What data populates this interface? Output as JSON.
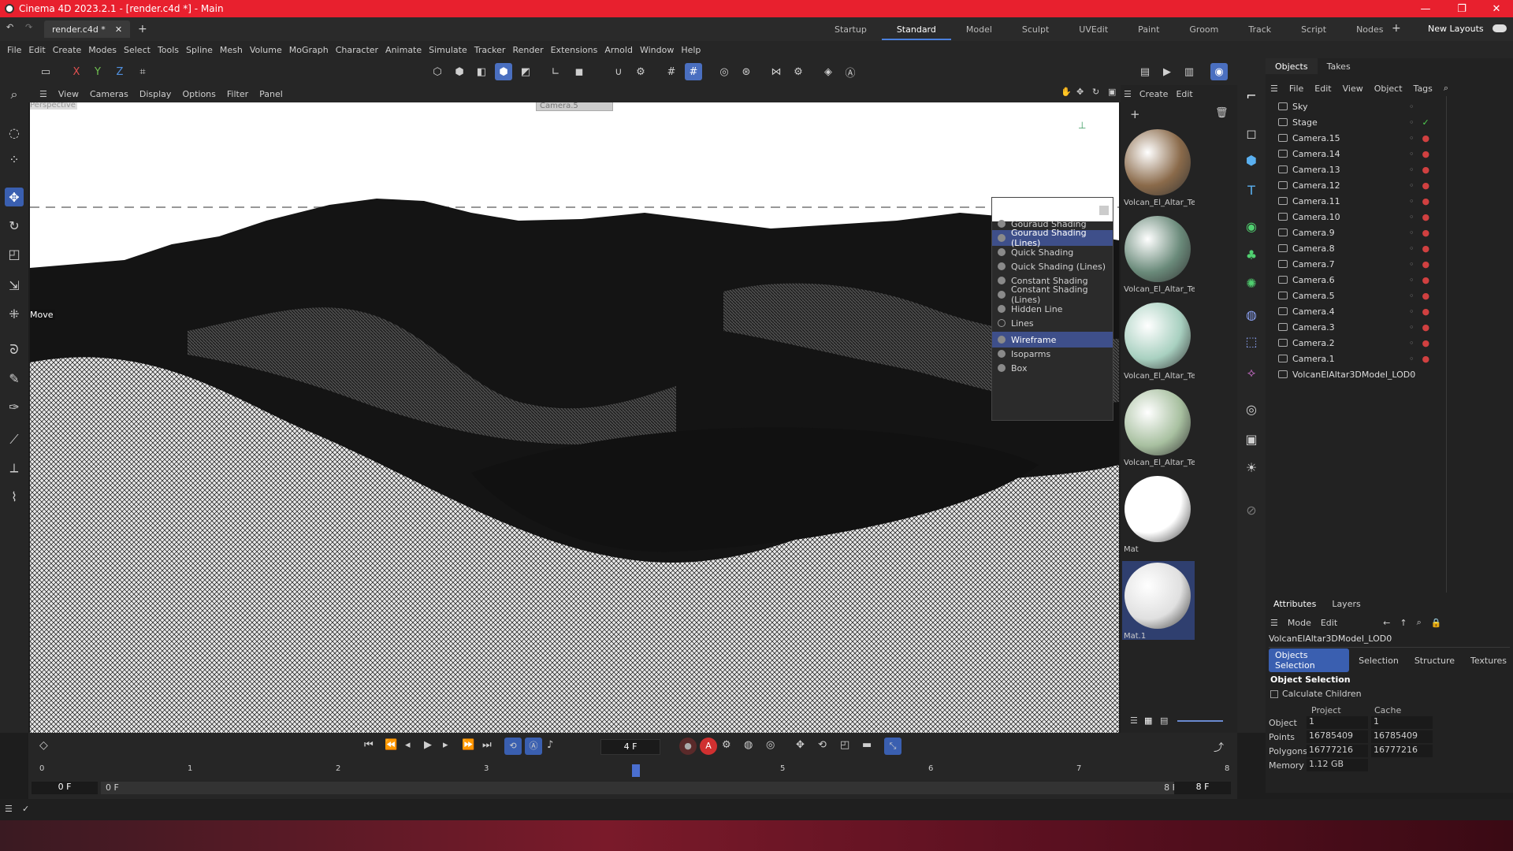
{
  "window": {
    "title": "Cinema 4D 2023.2.1 - [render.c4d *] - Main"
  },
  "doc_tab": {
    "label": "render.c4d *"
  },
  "layouts": [
    "Startup",
    "Standard",
    "Model",
    "Sculpt",
    "UVEdit",
    "Paint",
    "Groom",
    "Track",
    "Script",
    "Nodes"
  ],
  "layouts_active": "Standard",
  "new_layouts_label": "New Layouts",
  "menu": [
    "File",
    "Edit",
    "Create",
    "Modes",
    "Select",
    "Tools",
    "Spline",
    "Mesh",
    "Volume",
    "MoGraph",
    "Character",
    "Animate",
    "Simulate",
    "Tracker",
    "Render",
    "Extensions",
    "Arnold",
    "Window",
    "Help"
  ],
  "axis_labels": {
    "x": "X",
    "y": "Y",
    "z": "Z"
  },
  "viewport": {
    "menu": [
      "View",
      "Cameras",
      "Display",
      "Options",
      "Filter",
      "Panel"
    ],
    "label": "Perspective",
    "camera_label": "Camera.5",
    "hud_move": "Move"
  },
  "display_menu": {
    "items": [
      "Gouraud Shading",
      "Gouraud Shading (Lines)",
      "Quick Shading",
      "Quick Shading (Lines)",
      "Constant Shading",
      "Constant Shading (Lines)",
      "Hidden Line",
      "Lines",
      "Wireframe",
      "Isoparms",
      "Box"
    ],
    "selected": [
      "Gouraud Shading (Lines)",
      "Wireframe"
    ]
  },
  "materials": {
    "menu": [
      "Create",
      "Edit"
    ],
    "items": [
      {
        "label": "Volcan_El_Altar_Te",
        "color": "#8a6a4a"
      },
      {
        "label": "Volcan_El_Altar_Te",
        "color": "#6a8a7a"
      },
      {
        "label": "Volcan_El_Altar_Te",
        "color": "#a8d0c0"
      },
      {
        "label": "Volcan_El_Altar_Te",
        "color": "#a8c0a0"
      },
      {
        "label": "Mat",
        "color": "#ffffff"
      },
      {
        "label": "Mat.1",
        "color": "#e0e0e0"
      }
    ]
  },
  "objects_panel": {
    "tabs": [
      "Objects",
      "Takes"
    ],
    "menu": [
      "File",
      "Edit",
      "View",
      "Object",
      "Tags"
    ],
    "rows": [
      "Sky",
      "Stage",
      "Camera.15",
      "Camera.14",
      "Camera.13",
      "Camera.12",
      "Camera.11",
      "Camera.10",
      "Camera.9",
      "Camera.8",
      "Camera.7",
      "Camera.6",
      "Camera.5",
      "Camera.4",
      "Camera.3",
      "Camera.2",
      "Camera.1",
      "VolcanElAltar3DModel_LOD0"
    ]
  },
  "attributes": {
    "tabs": [
      "Attributes",
      "Layers"
    ],
    "menu": [
      "Mode",
      "Edit"
    ],
    "object_name": "VolcanElAltar3DModel_LOD0",
    "subtabs": [
      "Objects Selection",
      "Selection",
      "Structure",
      "Textures"
    ],
    "section": "Object Selection",
    "calc_children": "Calculate Children",
    "col_project": "Project",
    "col_cache": "Cache",
    "rows": [
      {
        "label": "Object",
        "project": "1",
        "cache": "1"
      },
      {
        "label": "Points",
        "project": "16785409",
        "cache": "16785409"
      },
      {
        "label": "Polygons",
        "project": "16777216",
        "cache": "16777216"
      },
      {
        "label": "Memory",
        "project": "1.12 GB",
        "cache": ""
      }
    ]
  },
  "timeline": {
    "current_frame": "4 F",
    "ticks": [
      "0",
      "1",
      "2",
      "3",
      "4",
      "5",
      "6",
      "7",
      "8"
    ],
    "start": "0 F",
    "start2": "0 F",
    "end": "8 F",
    "end2": "8 F"
  }
}
